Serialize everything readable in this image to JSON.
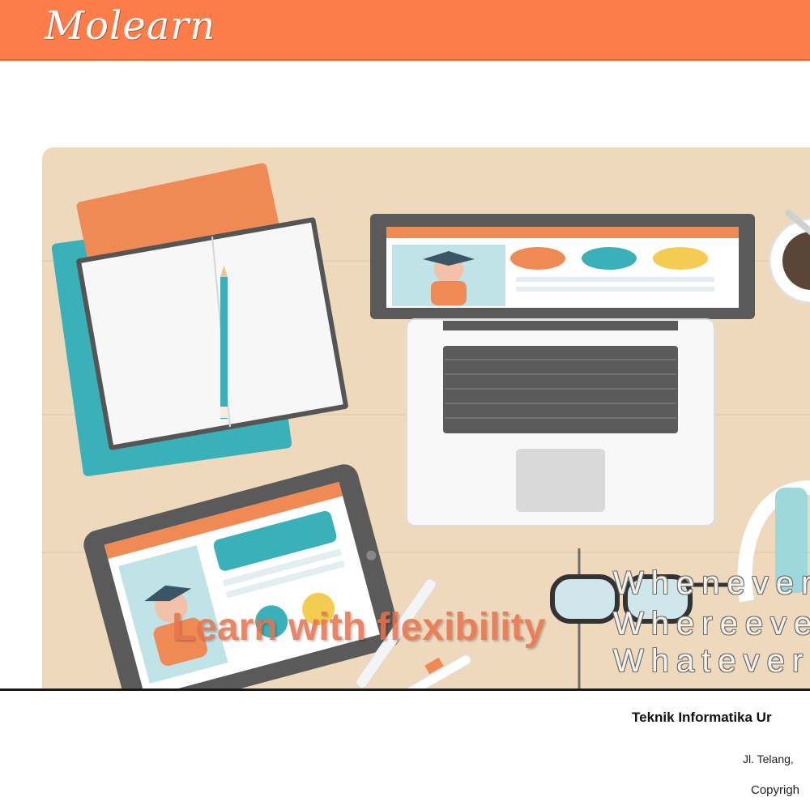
{
  "header": {
    "logo_text": "Molearn",
    "bg_color": "#fc7c4a"
  },
  "hero": {
    "slogan": "Learn with flexibility",
    "taglines": [
      "Whenever",
      "Whereever",
      "Whatever"
    ],
    "bg_color": "#efd9bd",
    "illustration": [
      "notebook-icon",
      "pencil-icon",
      "laptop-icon",
      "tablet-icon",
      "glasses-icon",
      "pen-icon",
      "coffee-cup-icon",
      "headphones-icon"
    ]
  },
  "footer": {
    "title": "Teknik Informatika Ur",
    "address": "Jl. Telang,",
    "copyright": "Copyrigh"
  }
}
